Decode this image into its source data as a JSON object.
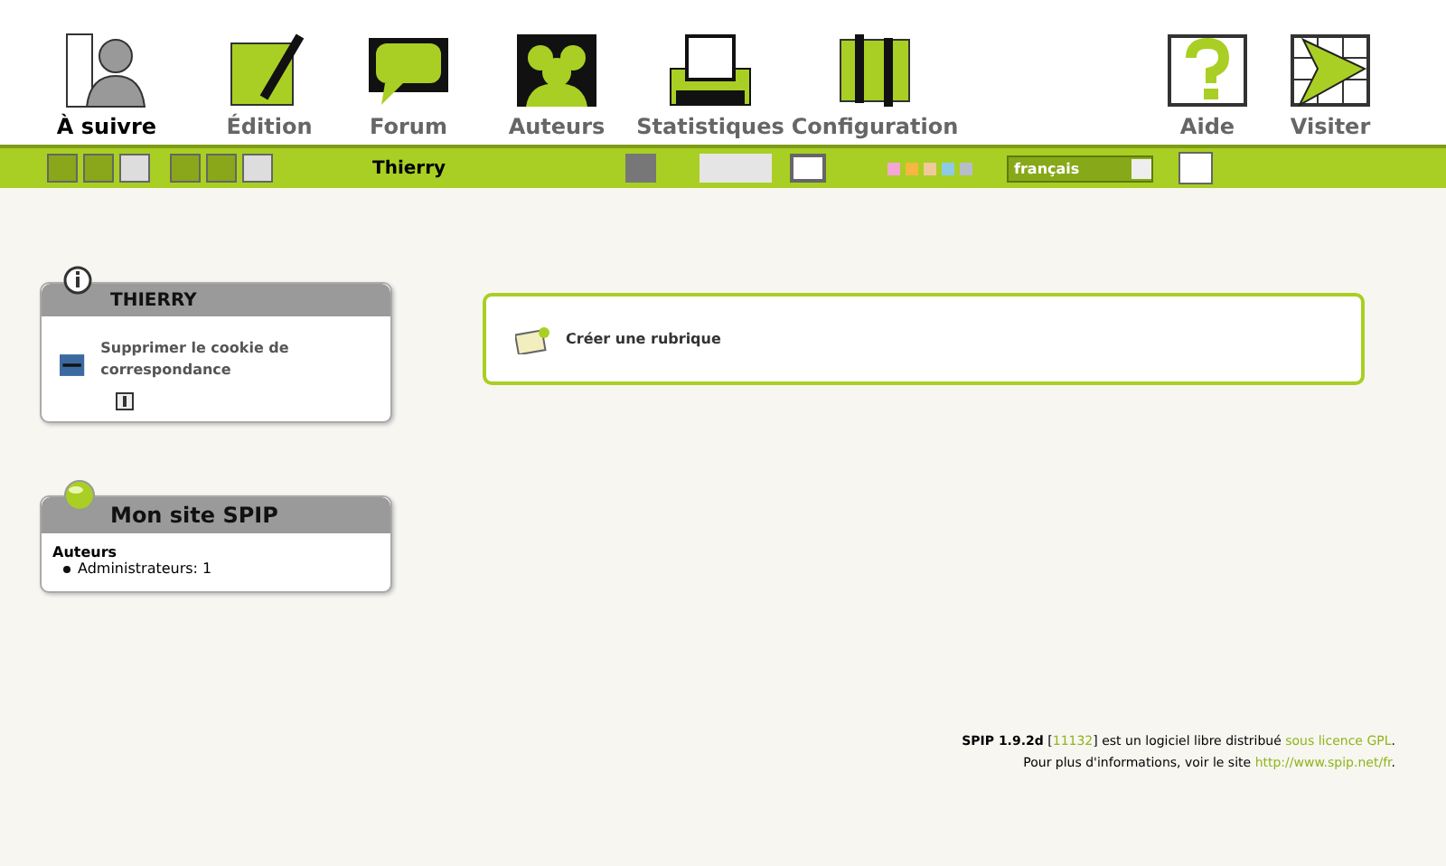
{
  "nav": [
    {
      "label": "À suivre",
      "selected": true
    },
    {
      "label": "Édition",
      "selected": false
    },
    {
      "label": "Forum",
      "selected": false
    },
    {
      "label": "Auteurs",
      "selected": false
    },
    {
      "label": "Statistiques",
      "selected": false
    },
    {
      "label": "Configuration",
      "selected": false
    },
    {
      "label": "Aide",
      "selected": false
    },
    {
      "label": "Visiter",
      "selected": false
    }
  ],
  "toolbar": {
    "user": "Thierry",
    "colors": [
      {
        "color": "#f4a6d6"
      },
      {
        "color": "#f5b642"
      },
      {
        "color": "#f2c99a"
      },
      {
        "color": "#8ecae6"
      },
      {
        "color": "#b7bccb"
      }
    ],
    "language": "français"
  },
  "info_box": {
    "title": "THIERRY",
    "action": "Supprimer le cookie de correspondance"
  },
  "site_box": {
    "title": "Mon site SPIP",
    "section": "Auteurs",
    "items": [
      "Administrateurs: 1"
    ]
  },
  "main": {
    "action": "Créer une rubrique"
  },
  "footer": [
    [
      {
        "kind": "bold",
        "text": "SPIP 1.9.2d"
      },
      {
        "kind": "text",
        "text": " ["
      },
      {
        "kind": "link",
        "text": "11132"
      },
      {
        "kind": "text",
        "text": "] est un logiciel libre distribué "
      },
      {
        "kind": "link",
        "text": "sous licence GPL"
      },
      {
        "kind": "text",
        "text": "."
      }
    ],
    [
      {
        "kind": "text",
        "text": "Pour plus d'informations, voir le site "
      },
      {
        "kind": "link",
        "text": "http://www.spip.net/fr"
      },
      {
        "kind": "text",
        "text": "."
      }
    ]
  ]
}
